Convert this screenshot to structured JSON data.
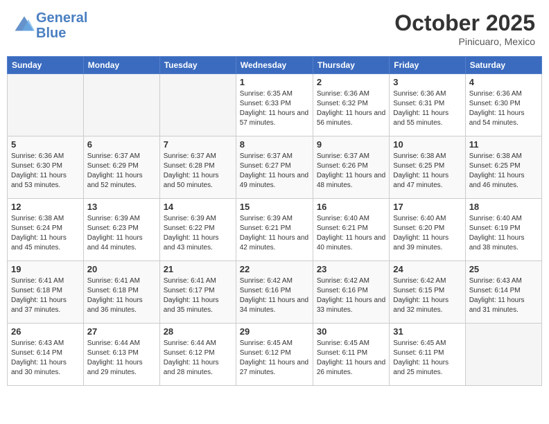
{
  "header": {
    "logo_line1": "General",
    "logo_line2": "Blue",
    "month": "October 2025",
    "location": "Pinicuaro, Mexico"
  },
  "weekdays": [
    "Sunday",
    "Monday",
    "Tuesday",
    "Wednesday",
    "Thursday",
    "Friday",
    "Saturday"
  ],
  "weeks": [
    [
      {
        "day": null
      },
      {
        "day": null
      },
      {
        "day": null
      },
      {
        "day": "1",
        "sunrise": "Sunrise: 6:35 AM",
        "sunset": "Sunset: 6:33 PM",
        "daylight": "Daylight: 11 hours and 57 minutes."
      },
      {
        "day": "2",
        "sunrise": "Sunrise: 6:36 AM",
        "sunset": "Sunset: 6:32 PM",
        "daylight": "Daylight: 11 hours and 56 minutes."
      },
      {
        "day": "3",
        "sunrise": "Sunrise: 6:36 AM",
        "sunset": "Sunset: 6:31 PM",
        "daylight": "Daylight: 11 hours and 55 minutes."
      },
      {
        "day": "4",
        "sunrise": "Sunrise: 6:36 AM",
        "sunset": "Sunset: 6:30 PM",
        "daylight": "Daylight: 11 hours and 54 minutes."
      }
    ],
    [
      {
        "day": "5",
        "sunrise": "Sunrise: 6:36 AM",
        "sunset": "Sunset: 6:30 PM",
        "daylight": "Daylight: 11 hours and 53 minutes."
      },
      {
        "day": "6",
        "sunrise": "Sunrise: 6:37 AM",
        "sunset": "Sunset: 6:29 PM",
        "daylight": "Daylight: 11 hours and 52 minutes."
      },
      {
        "day": "7",
        "sunrise": "Sunrise: 6:37 AM",
        "sunset": "Sunset: 6:28 PM",
        "daylight": "Daylight: 11 hours and 50 minutes."
      },
      {
        "day": "8",
        "sunrise": "Sunrise: 6:37 AM",
        "sunset": "Sunset: 6:27 PM",
        "daylight": "Daylight: 11 hours and 49 minutes."
      },
      {
        "day": "9",
        "sunrise": "Sunrise: 6:37 AM",
        "sunset": "Sunset: 6:26 PM",
        "daylight": "Daylight: 11 hours and 48 minutes."
      },
      {
        "day": "10",
        "sunrise": "Sunrise: 6:38 AM",
        "sunset": "Sunset: 6:25 PM",
        "daylight": "Daylight: 11 hours and 47 minutes."
      },
      {
        "day": "11",
        "sunrise": "Sunrise: 6:38 AM",
        "sunset": "Sunset: 6:25 PM",
        "daylight": "Daylight: 11 hours and 46 minutes."
      }
    ],
    [
      {
        "day": "12",
        "sunrise": "Sunrise: 6:38 AM",
        "sunset": "Sunset: 6:24 PM",
        "daylight": "Daylight: 11 hours and 45 minutes."
      },
      {
        "day": "13",
        "sunrise": "Sunrise: 6:39 AM",
        "sunset": "Sunset: 6:23 PM",
        "daylight": "Daylight: 11 hours and 44 minutes."
      },
      {
        "day": "14",
        "sunrise": "Sunrise: 6:39 AM",
        "sunset": "Sunset: 6:22 PM",
        "daylight": "Daylight: 11 hours and 43 minutes."
      },
      {
        "day": "15",
        "sunrise": "Sunrise: 6:39 AM",
        "sunset": "Sunset: 6:21 PM",
        "daylight": "Daylight: 11 hours and 42 minutes."
      },
      {
        "day": "16",
        "sunrise": "Sunrise: 6:40 AM",
        "sunset": "Sunset: 6:21 PM",
        "daylight": "Daylight: 11 hours and 40 minutes."
      },
      {
        "day": "17",
        "sunrise": "Sunrise: 6:40 AM",
        "sunset": "Sunset: 6:20 PM",
        "daylight": "Daylight: 11 hours and 39 minutes."
      },
      {
        "day": "18",
        "sunrise": "Sunrise: 6:40 AM",
        "sunset": "Sunset: 6:19 PM",
        "daylight": "Daylight: 11 hours and 38 minutes."
      }
    ],
    [
      {
        "day": "19",
        "sunrise": "Sunrise: 6:41 AM",
        "sunset": "Sunset: 6:18 PM",
        "daylight": "Daylight: 11 hours and 37 minutes."
      },
      {
        "day": "20",
        "sunrise": "Sunrise: 6:41 AM",
        "sunset": "Sunset: 6:18 PM",
        "daylight": "Daylight: 11 hours and 36 minutes."
      },
      {
        "day": "21",
        "sunrise": "Sunrise: 6:41 AM",
        "sunset": "Sunset: 6:17 PM",
        "daylight": "Daylight: 11 hours and 35 minutes."
      },
      {
        "day": "22",
        "sunrise": "Sunrise: 6:42 AM",
        "sunset": "Sunset: 6:16 PM",
        "daylight": "Daylight: 11 hours and 34 minutes."
      },
      {
        "day": "23",
        "sunrise": "Sunrise: 6:42 AM",
        "sunset": "Sunset: 6:16 PM",
        "daylight": "Daylight: 11 hours and 33 minutes."
      },
      {
        "day": "24",
        "sunrise": "Sunrise: 6:42 AM",
        "sunset": "Sunset: 6:15 PM",
        "daylight": "Daylight: 11 hours and 32 minutes."
      },
      {
        "day": "25",
        "sunrise": "Sunrise: 6:43 AM",
        "sunset": "Sunset: 6:14 PM",
        "daylight": "Daylight: 11 hours and 31 minutes."
      }
    ],
    [
      {
        "day": "26",
        "sunrise": "Sunrise: 6:43 AM",
        "sunset": "Sunset: 6:14 PM",
        "daylight": "Daylight: 11 hours and 30 minutes."
      },
      {
        "day": "27",
        "sunrise": "Sunrise: 6:44 AM",
        "sunset": "Sunset: 6:13 PM",
        "daylight": "Daylight: 11 hours and 29 minutes."
      },
      {
        "day": "28",
        "sunrise": "Sunrise: 6:44 AM",
        "sunset": "Sunset: 6:12 PM",
        "daylight": "Daylight: 11 hours and 28 minutes."
      },
      {
        "day": "29",
        "sunrise": "Sunrise: 6:45 AM",
        "sunset": "Sunset: 6:12 PM",
        "daylight": "Daylight: 11 hours and 27 minutes."
      },
      {
        "day": "30",
        "sunrise": "Sunrise: 6:45 AM",
        "sunset": "Sunset: 6:11 PM",
        "daylight": "Daylight: 11 hours and 26 minutes."
      },
      {
        "day": "31",
        "sunrise": "Sunrise: 6:45 AM",
        "sunset": "Sunset: 6:11 PM",
        "daylight": "Daylight: 11 hours and 25 minutes."
      },
      {
        "day": null
      }
    ]
  ]
}
